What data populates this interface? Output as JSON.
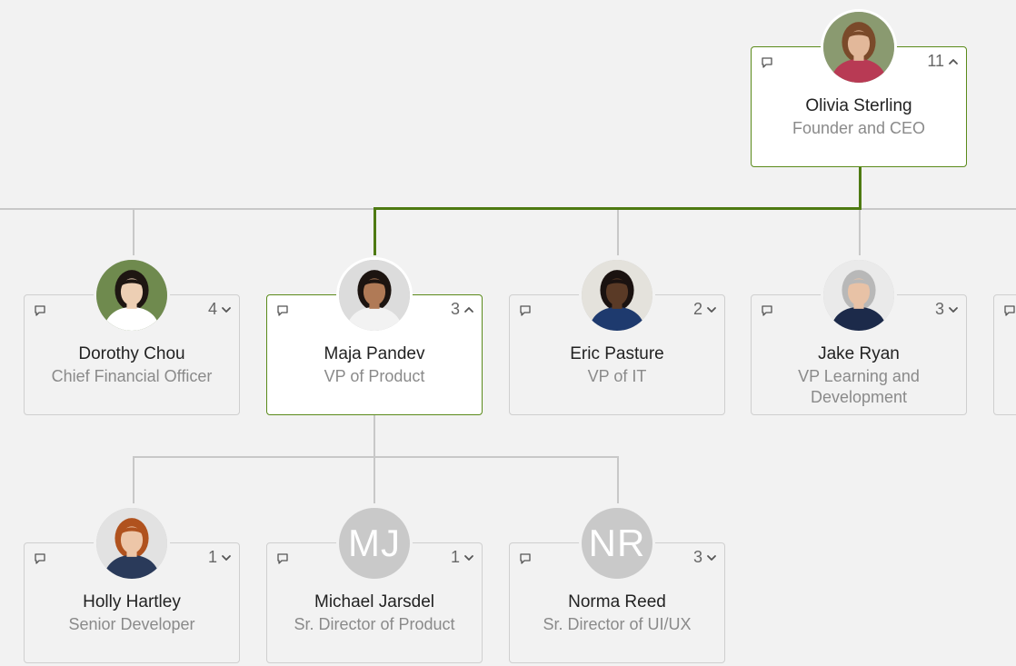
{
  "colors": {
    "background": "#f2f2f2",
    "connector": "#c8c8c8",
    "active_connector": "#4e7a12",
    "selected_border": "#5a8a1a",
    "initials_avatar": "#c9c9c9"
  },
  "nodes": [
    {
      "id": "olivia",
      "name": "Olivia Sterling",
      "title": "Founder and CEO",
      "count": "11",
      "expanded": true,
      "selected": true,
      "avatar": {
        "type": "photo",
        "skin": "#e2b89a",
        "hair": "#7a4a2a",
        "shirt": "#b83a54",
        "bg": "#8a9a70"
      }
    },
    {
      "id": "dorothy",
      "name": "Dorothy Chou",
      "title": "Chief Financial Officer",
      "count": "4",
      "expanded": false,
      "selected": false,
      "avatar": {
        "type": "photo",
        "skin": "#edcfb4",
        "hair": "#1e1612",
        "shirt": "#ffffff",
        "bg": "#6f8a4e"
      }
    },
    {
      "id": "maja",
      "name": "Maja Pandev",
      "title": "VP of Product",
      "count": "3",
      "expanded": true,
      "selected": true,
      "avatar": {
        "type": "photo",
        "skin": "#b07a56",
        "hair": "#1c1410",
        "shirt": "#f2f2f2",
        "bg": "#dcdcdc"
      }
    },
    {
      "id": "eric",
      "name": "Eric Pasture",
      "title": "VP of IT",
      "count": "2",
      "expanded": false,
      "selected": false,
      "avatar": {
        "type": "photo",
        "skin": "#5a3a26",
        "hair": "#1a1210",
        "shirt": "#1e3a6e",
        "bg": "#e4e2dc"
      }
    },
    {
      "id": "jake",
      "name": "Jake Ryan",
      "title": "VP Learning and Development",
      "count": "3",
      "expanded": false,
      "selected": false,
      "avatar": {
        "type": "photo",
        "skin": "#e8c2a6",
        "hair": "#b8b8b8",
        "shirt": "#1c2a4a",
        "bg": "#eaeaea"
      }
    },
    {
      "id": "partial",
      "name": "",
      "title": "",
      "count": "",
      "expanded": false,
      "selected": false,
      "avatar": {
        "type": "none"
      }
    },
    {
      "id": "holly",
      "name": "Holly Hartley",
      "title": "Senior Developer",
      "count": "1",
      "expanded": false,
      "selected": false,
      "avatar": {
        "type": "photo",
        "skin": "#edc6a8",
        "hair": "#b0521e",
        "shirt": "#2a3a5a",
        "bg": "#e2e2e2"
      }
    },
    {
      "id": "michael",
      "name": "Michael Jarsdel",
      "title": "Sr. Director of Product",
      "count": "1",
      "expanded": false,
      "selected": false,
      "avatar": {
        "type": "initials",
        "initials": "MJ"
      }
    },
    {
      "id": "norma",
      "name": "Norma Reed",
      "title": "Sr. Director of UI/UX",
      "count": "3",
      "expanded": false,
      "selected": false,
      "avatar": {
        "type": "initials",
        "initials": "NR"
      }
    }
  ]
}
